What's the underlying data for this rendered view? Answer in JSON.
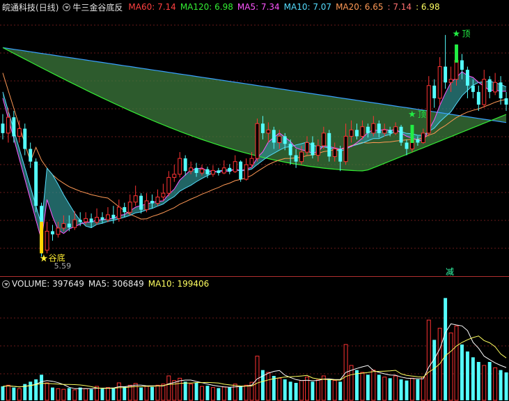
{
  "header": {
    "stock_name": "皖通科技",
    "period": "(日线)",
    "indicator_name": "牛三金谷底反",
    "ma60": "MA60: 7.14",
    "ma120": "MA120: 6.98",
    "ma5": "MA5: 7.34",
    "ma10": "MA10: 7.07",
    "ma20": "MA20: 6.65",
    "extra1": ": 7.14",
    "extra2": ": 6.98"
  },
  "volume_header": {
    "volume": "VOLUME: 397649",
    "ma5": "MA5: 306849",
    "ma10": "MA10: 199406"
  },
  "markers": {
    "bottom": "谷底",
    "top": "顶",
    "low_value": "5.59",
    "reduce": "减"
  },
  "colors": {
    "up": "#ff3333",
    "down": "#54ffff",
    "ma60": "#ff4040",
    "ma120": "#33ee33",
    "ma5": "#ff55ff",
    "ma10": "#55ddff",
    "ma20": "#ff9955",
    "extra1": "#ff7070",
    "extra2": "#ffff60",
    "long_band": "#3c7a3c",
    "short_band_up": "#8a2e8a",
    "short_band_down": "#2f8f8f"
  },
  "chart_data": {
    "type": "candlestick",
    "y_low_label": 5.59,
    "candles": [
      [
        7.7,
        7.55,
        7.85,
        7.45
      ],
      [
        7.55,
        7.8,
        7.95,
        7.4
      ],
      [
        7.8,
        7.5,
        7.9,
        7.4
      ],
      [
        7.5,
        7.62,
        7.75,
        7.4
      ],
      [
        7.62,
        7.3,
        7.7,
        7.2
      ],
      [
        7.3,
        7.1,
        7.4,
        7.0
      ],
      [
        7.1,
        6.4,
        7.15,
        6.3
      ],
      [
        6.4,
        5.7,
        6.45,
        5.6
      ],
      [
        5.7,
        6.0,
        6.15,
        5.65
      ],
      [
        6.0,
        5.95,
        6.1,
        5.85
      ],
      [
        5.95,
        6.05,
        6.15,
        5.9
      ],
      [
        6.05,
        6.12,
        6.25,
        6.0
      ],
      [
        6.12,
        6.06,
        6.25,
        6.0
      ],
      [
        6.06,
        6.18,
        6.32,
        6.02
      ],
      [
        6.18,
        6.15,
        6.3,
        6.08
      ],
      [
        6.15,
        6.2,
        6.3,
        6.1
      ],
      [
        6.2,
        6.14,
        6.28,
        6.05
      ],
      [
        6.14,
        6.22,
        6.36,
        6.1
      ],
      [
        6.22,
        6.18,
        6.3,
        6.12
      ],
      [
        6.18,
        6.26,
        6.38,
        6.14
      ],
      [
        6.26,
        6.2,
        6.4,
        6.12
      ],
      [
        6.2,
        6.38,
        6.5,
        6.15
      ],
      [
        6.38,
        6.3,
        6.45,
        6.22
      ],
      [
        6.3,
        6.46,
        6.58,
        6.25
      ],
      [
        6.46,
        6.56,
        6.72,
        6.4
      ],
      [
        6.56,
        6.34,
        6.6,
        6.28
      ],
      [
        6.34,
        6.48,
        6.6,
        6.3
      ],
      [
        6.48,
        6.44,
        6.58,
        6.36
      ],
      [
        6.44,
        6.54,
        6.66,
        6.4
      ],
      [
        6.54,
        6.6,
        6.75,
        6.48
      ],
      [
        6.6,
        6.85,
        6.95,
        6.55
      ],
      [
        6.85,
        6.9,
        7.05,
        6.78
      ],
      [
        6.9,
        7.15,
        7.25,
        6.85
      ],
      [
        7.15,
        6.95,
        7.2,
        6.88
      ],
      [
        6.95,
        7.0,
        7.1,
        6.9
      ],
      [
        7.0,
        6.92,
        7.08,
        6.86
      ],
      [
        6.92,
        6.98,
        7.05,
        6.88
      ],
      [
        6.98,
        6.9,
        7.02,
        6.84
      ],
      [
        6.9,
        6.96,
        7.04,
        6.86
      ],
      [
        6.96,
        6.92,
        7.0,
        6.88
      ],
      [
        6.92,
        7.0,
        7.12,
        6.9
      ],
      [
        7.0,
        6.94,
        7.06,
        6.9
      ],
      [
        6.94,
        7.1,
        7.2,
        6.92
      ],
      [
        7.1,
        6.82,
        7.12,
        6.78
      ],
      [
        6.82,
        7.05,
        7.15,
        6.8
      ],
      [
        7.05,
        7.15,
        7.25,
        7.0
      ],
      [
        7.15,
        7.7,
        7.78,
        7.1
      ],
      [
        7.7,
        7.55,
        7.82,
        7.45
      ],
      [
        7.55,
        7.6,
        7.72,
        7.4
      ],
      [
        7.6,
        7.4,
        7.65,
        7.3
      ],
      [
        7.4,
        7.5,
        7.6,
        7.3
      ],
      [
        7.5,
        7.38,
        7.55,
        7.28
      ],
      [
        7.38,
        7.2,
        7.45,
        7.05
      ],
      [
        7.2,
        7.1,
        7.3,
        7.0
      ],
      [
        7.1,
        7.25,
        7.35,
        7.05
      ],
      [
        7.25,
        7.4,
        7.5,
        7.2
      ],
      [
        7.4,
        7.2,
        7.5,
        7.15
      ],
      [
        7.2,
        7.35,
        7.45,
        7.1
      ],
      [
        7.35,
        7.55,
        7.65,
        7.3
      ],
      [
        7.55,
        7.18,
        7.6,
        7.1
      ],
      [
        7.18,
        7.3,
        7.4,
        7.1
      ],
      [
        7.3,
        7.1,
        7.35,
        6.95
      ],
      [
        7.1,
        7.5,
        7.7,
        7.05
      ],
      [
        7.5,
        7.6,
        7.75,
        7.4
      ],
      [
        7.6,
        7.5,
        7.7,
        7.45
      ],
      [
        7.5,
        7.65,
        7.75,
        7.45
      ],
      [
        7.65,
        7.55,
        7.7,
        7.48
      ],
      [
        7.55,
        7.7,
        7.82,
        7.5
      ],
      [
        7.7,
        7.55,
        7.75,
        7.48
      ],
      [
        7.55,
        7.6,
        7.7,
        7.5
      ],
      [
        7.6,
        7.55,
        7.65,
        7.5
      ],
      [
        7.55,
        7.65,
        7.72,
        7.52
      ],
      [
        7.65,
        7.4,
        7.68,
        7.35
      ],
      [
        7.4,
        7.3,
        7.45,
        7.2
      ],
      [
        7.3,
        7.45,
        7.55,
        7.25
      ],
      [
        7.45,
        7.4,
        7.5,
        7.35
      ],
      [
        7.4,
        7.55,
        7.62,
        7.38
      ],
      [
        7.55,
        8.3,
        8.45,
        7.5
      ],
      [
        8.3,
        8.1,
        8.4,
        7.95
      ],
      [
        8.1,
        8.6,
        8.75,
        8.0
      ],
      [
        8.6,
        8.35,
        9.1,
        8.25
      ],
      [
        8.35,
        8.4,
        8.6,
        8.2
      ],
      [
        8.4,
        8.7,
        8.95,
        8.3
      ],
      [
        8.7,
        8.55,
        8.8,
        8.4
      ],
      [
        8.55,
        8.3,
        8.6,
        8.1
      ],
      [
        8.3,
        8.2,
        8.4,
        8.1
      ],
      [
        8.2,
        8.0,
        8.3,
        7.9
      ],
      [
        8.0,
        8.4,
        8.55,
        7.95
      ],
      [
        8.4,
        8.2,
        8.45,
        8.1
      ],
      [
        8.2,
        8.35,
        8.5,
        8.15
      ],
      [
        8.35,
        8.1,
        8.45,
        8.0
      ],
      [
        8.1,
        8.0,
        8.2,
        7.9
      ]
    ],
    "volumes": [
      120,
      130,
      110,
      100,
      140,
      160,
      180,
      220,
      150,
      110,
      100,
      95,
      105,
      90,
      110,
      100,
      95,
      120,
      100,
      110,
      105,
      150,
      120,
      130,
      145,
      110,
      120,
      115,
      130,
      140,
      210,
      170,
      190,
      160,
      140,
      150,
      120,
      125,
      110,
      105,
      115,
      110,
      140,
      120,
      130,
      155,
      380,
      260,
      240,
      210,
      190,
      180,
      160,
      150,
      170,
      200,
      160,
      175,
      210,
      180,
      170,
      160,
      480,
      300,
      260,
      240,
      220,
      260,
      220,
      200,
      190,
      210,
      180,
      170,
      190,
      180,
      200,
      690,
      520,
      620,
      880,
      580,
      640,
      480,
      420,
      370,
      330,
      300,
      330,
      280,
      260,
      240
    ],
    "volume_ma5": 306849,
    "volume_ma10": 199406
  }
}
